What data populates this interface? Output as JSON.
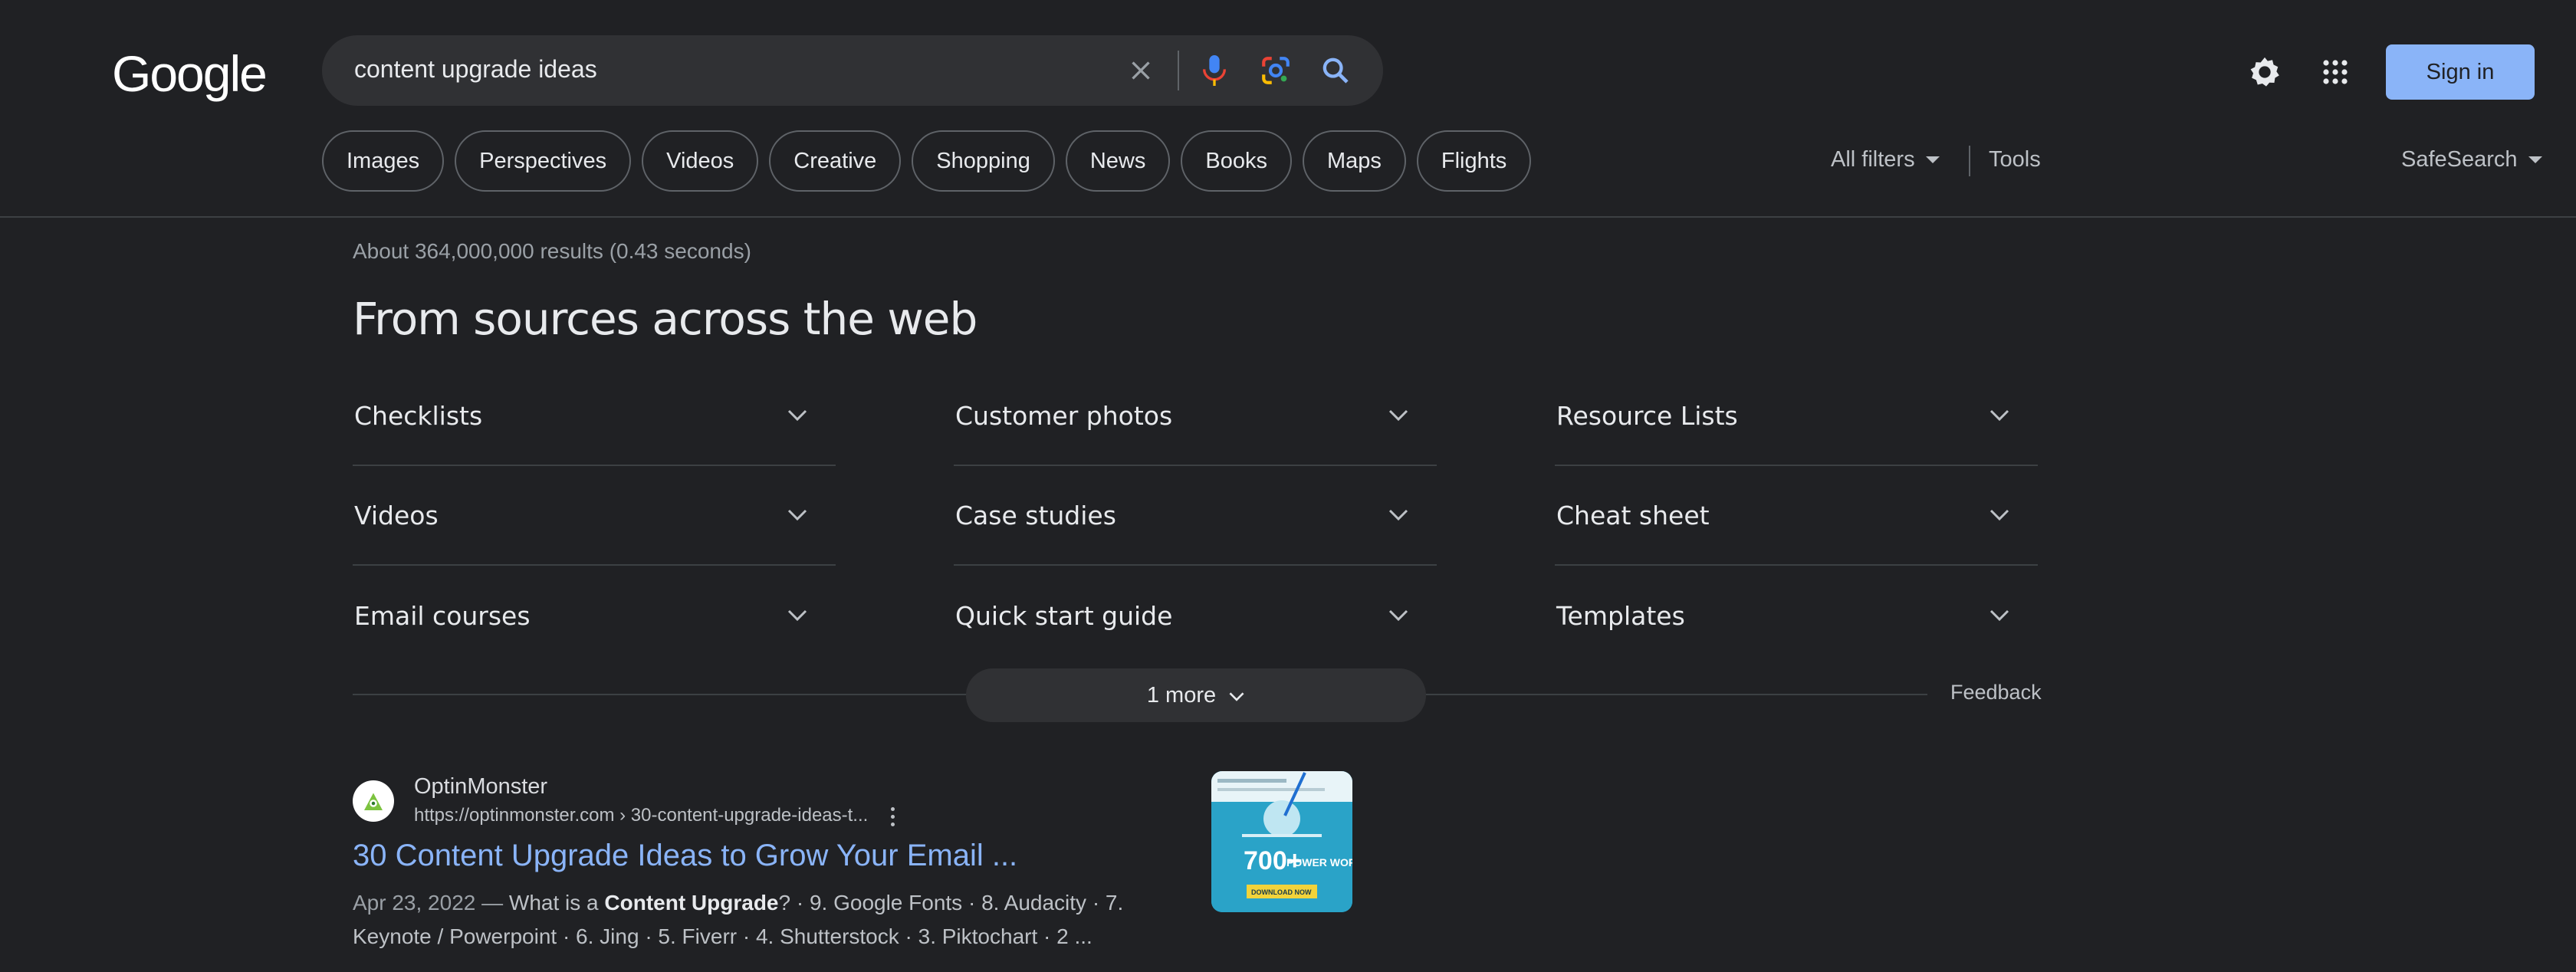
{
  "logo": "Google",
  "search": {
    "query": "content upgrade ideas"
  },
  "header": {
    "sign_in": "Sign in"
  },
  "chips": [
    "Images",
    "Perspectives",
    "Videos",
    "Creative",
    "Shopping",
    "News",
    "Books",
    "Maps",
    "Flights"
  ],
  "filters": {
    "all_filters": "All filters",
    "tools": "Tools",
    "safesearch": "SafeSearch"
  },
  "stats": "About 364,000,000 results (0.43 seconds)",
  "section": {
    "title": "From sources across the web",
    "columns": [
      [
        "Checklists",
        "Videos",
        "Email courses"
      ],
      [
        "Customer photos",
        "Case studies",
        "Quick start guide"
      ],
      [
        "Resource Lists",
        "Cheat sheet",
        "Templates"
      ]
    ],
    "more": "1 more",
    "feedback": "Feedback"
  },
  "result": {
    "site_name": "OptinMonster",
    "url": "https://optinmonster.com › 30-content-upgrade-ideas-t...",
    "title": "30 Content Upgrade Ideas to Grow Your Email ...",
    "date": "Apr 23, 2022 —",
    "snippet_pre": " What is a ",
    "snippet_bold": "Content Upgrade",
    "snippet_post": "? · 9. Google Fonts · 8. Audacity · 7. Keynote / Powerpoint · 6. Jing · 5. Fiverr · 4. Shutterstock · 3. Piktochart · 2 ...",
    "thumb_big": "700+",
    "thumb_words": "POWER WORDS",
    "thumb_cta": "DOWNLOAD NOW"
  },
  "colors": {
    "background": "#202124",
    "accent": "#8ab4f8",
    "surface": "#303134"
  }
}
